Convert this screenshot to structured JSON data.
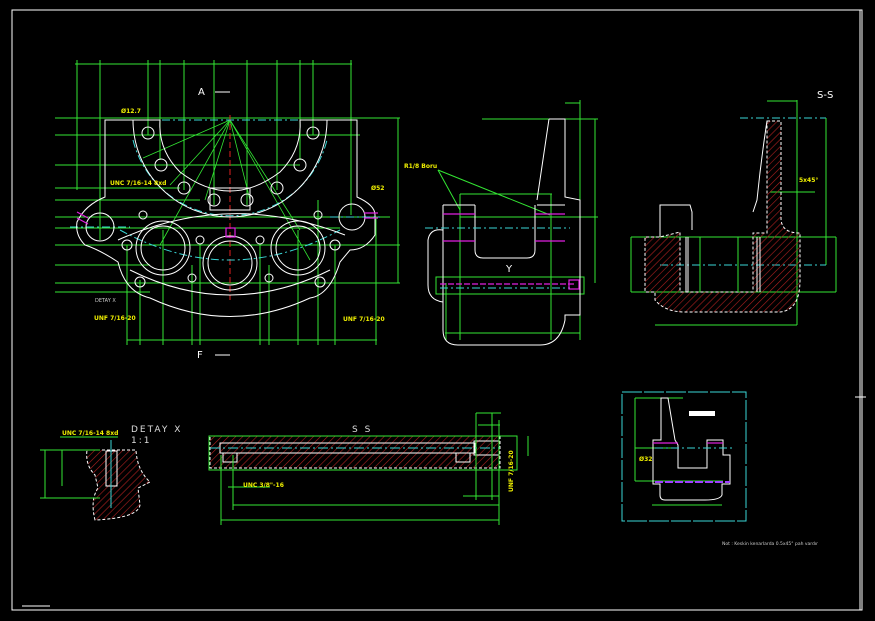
{
  "drawing": {
    "colors": {
      "background": "#000000",
      "outline": "#ffffff",
      "dimension": "#33e633",
      "center": "#3ad6d6",
      "thread": "#e020e0",
      "text": "#f0f000",
      "hatch": "#b02020"
    },
    "front_view": {
      "section_marker_top": "A",
      "section_marker_bottom": "F",
      "callouts": [
        "Ø12.7",
        "UNC 7/16-14 8xd",
        "Ø52",
        "DETAY X",
        "UNF 7/16-20",
        "UNF 7/16-20"
      ]
    },
    "side_view": {
      "pipe_label": "R1/8 Boru",
      "view_letter": "Y"
    },
    "section_view": {
      "title": "S-S",
      "chamfer": "5x45°"
    },
    "detail_view": {
      "title": "DETAY X",
      "scale": "1:1",
      "thread": "UNC 7/16-14 8xd"
    },
    "bar_section": {
      "title": "S S",
      "thread": "UNC 3/8\"-16",
      "thread_right": "UNF 7/16-20"
    },
    "small_view": {
      "diameter": "Ø32"
    },
    "note": "Not : Keskin kenarlarda 0.5x45° pah vardır"
  }
}
